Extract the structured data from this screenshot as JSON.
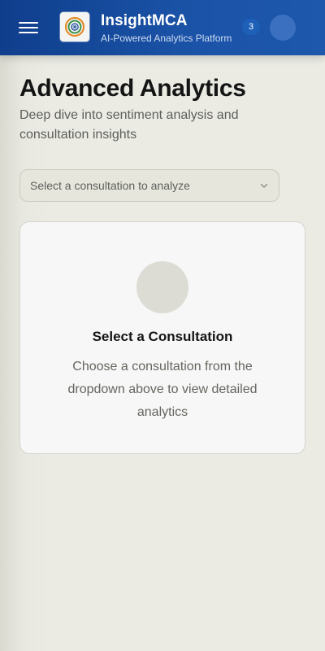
{
  "header": {
    "title": "InsightMCA",
    "subtitle": "AI-Powered Analytics Platform",
    "notification_count": "3",
    "menu_icon": "hamburger-menu-icon",
    "logo_icon": "emblem-logo-icon",
    "colors": {
      "bar": "#1a52a6",
      "badge": "#1e5fb8",
      "avatar": "#3a70bf"
    }
  },
  "main": {
    "title": "Advanced Analytics",
    "subtitle": "Deep dive into sentiment analysis and consultation insights",
    "select": {
      "placeholder": "Select a consultation to analyze",
      "icon": "chevron-down-icon"
    },
    "empty_state": {
      "title": "Select a Consultation",
      "description": "Choose a consultation from the dropdown above to view detailed analytics"
    }
  }
}
